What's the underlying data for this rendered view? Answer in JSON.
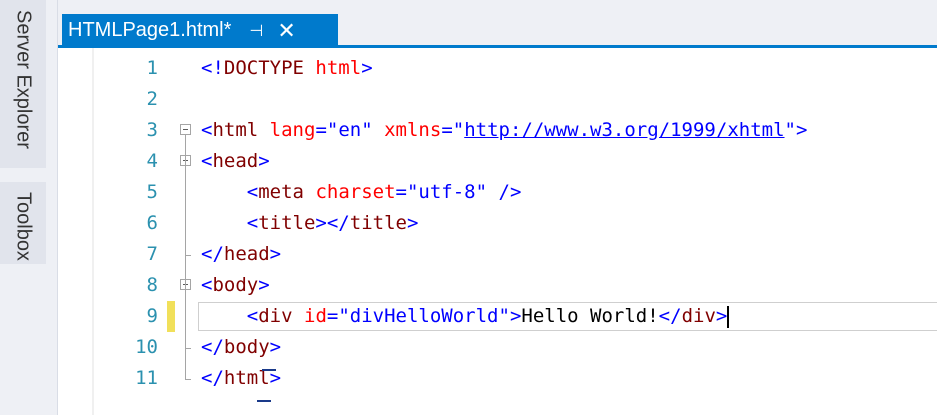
{
  "side_panel": {
    "server_explorer": "Server Explorer",
    "toolbox": "Toolbox"
  },
  "tab": {
    "title": "HTMLPage1.html*",
    "pin_glyph": "⊣",
    "close_glyph": "✕"
  },
  "editor": {
    "lines": [
      {
        "number": "1",
        "tokens": [
          {
            "t": "brk",
            "v": "<!"
          },
          {
            "t": "tag",
            "v": "DOCTYPE"
          },
          {
            "t": "text",
            "v": " "
          },
          {
            "t": "attr",
            "v": "html"
          },
          {
            "t": "brk",
            "v": ">"
          }
        ]
      },
      {
        "number": "2",
        "tokens": []
      },
      {
        "number": "3",
        "tokens": [
          {
            "t": "brk",
            "v": "<"
          },
          {
            "t": "tag",
            "v": "html"
          },
          {
            "t": "text",
            "v": " "
          },
          {
            "t": "attr",
            "v": "lang"
          },
          {
            "t": "brk",
            "v": "="
          },
          {
            "t": "val",
            "v": "\"en\""
          },
          {
            "t": "text",
            "v": " "
          },
          {
            "t": "attr",
            "v": "xmlns"
          },
          {
            "t": "brk",
            "v": "="
          },
          {
            "t": "val",
            "v": "\""
          },
          {
            "t": "url",
            "v": "http://www.w3.org/1999/xhtml"
          },
          {
            "t": "val",
            "v": "\""
          },
          {
            "t": "brk",
            "v": ">"
          }
        ]
      },
      {
        "number": "4",
        "tokens": [
          {
            "t": "brk",
            "v": "<"
          },
          {
            "t": "tag",
            "v": "head"
          },
          {
            "t": "brk",
            "v": ">"
          }
        ]
      },
      {
        "number": "5",
        "tokens": [
          {
            "t": "text",
            "v": "    "
          },
          {
            "t": "brk",
            "v": "<"
          },
          {
            "t": "tag",
            "v": "meta"
          },
          {
            "t": "text",
            "v": " "
          },
          {
            "t": "attr",
            "v": "charset"
          },
          {
            "t": "brk",
            "v": "="
          },
          {
            "t": "val",
            "v": "\"utf-8\""
          },
          {
            "t": "text",
            "v": " "
          },
          {
            "t": "brk",
            "v": "/>"
          }
        ]
      },
      {
        "number": "6",
        "tokens": [
          {
            "t": "text",
            "v": "    "
          },
          {
            "t": "brk",
            "v": "<"
          },
          {
            "t": "tag",
            "v": "title"
          },
          {
            "t": "brk",
            "v": "></"
          },
          {
            "t": "tag",
            "v": "title"
          },
          {
            "t": "brk",
            "v": ">"
          }
        ]
      },
      {
        "number": "7",
        "tokens": [
          {
            "t": "brk",
            "v": "</"
          },
          {
            "t": "tag",
            "v": "head"
          },
          {
            "t": "brk",
            "v": ">"
          }
        ]
      },
      {
        "number": "8",
        "tokens": [
          {
            "t": "brk",
            "v": "<"
          },
          {
            "t": "tag",
            "v": "body"
          },
          {
            "t": "brk",
            "v": ">"
          }
        ]
      },
      {
        "number": "9",
        "tokens": [
          {
            "t": "text",
            "v": "    "
          },
          {
            "t": "brk",
            "v": "<"
          },
          {
            "t": "tag",
            "v": "div"
          },
          {
            "t": "text",
            "v": " "
          },
          {
            "t": "attr",
            "v": "id"
          },
          {
            "t": "brk",
            "v": "="
          },
          {
            "t": "val",
            "v": "\"divHelloWorld\""
          },
          {
            "t": "brk",
            "v": ">"
          },
          {
            "t": "text",
            "v": "Hello World!"
          },
          {
            "t": "brk",
            "v": "</"
          },
          {
            "t": "tag",
            "v": "div"
          },
          {
            "t": "brk",
            "v": ">"
          }
        ]
      },
      {
        "number": "10",
        "tokens": [
          {
            "t": "brk",
            "v": "</"
          },
          {
            "t": "tag",
            "v": "body"
          },
          {
            "t": "brk",
            "v": ">"
          }
        ]
      },
      {
        "number": "11",
        "tokens": [
          {
            "t": "brk",
            "v": "</"
          },
          {
            "t": "tag",
            "v": "html"
          },
          {
            "t": "brk",
            "v": ">"
          }
        ]
      }
    ]
  }
}
